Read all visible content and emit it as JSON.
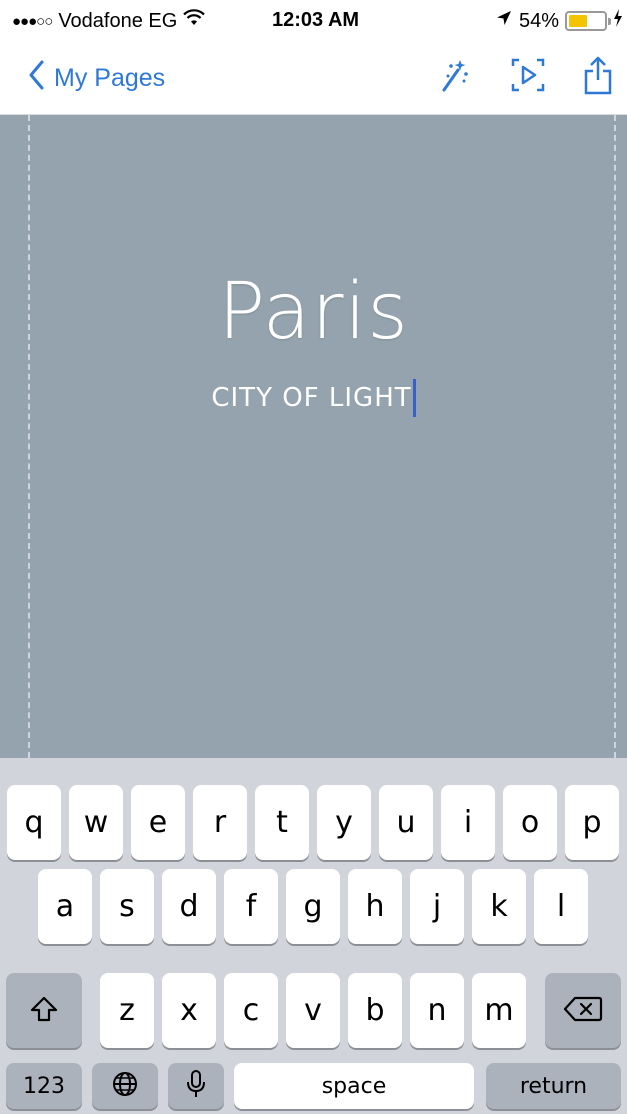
{
  "status_bar": {
    "signal": "●●●○○",
    "carrier": "Vodafone EG",
    "wifi_icon": "wifi-icon",
    "time": "12:03 AM",
    "location_icon": "location-arrow-icon",
    "battery_percent": "54%",
    "battery_level": 0.54,
    "charging_icon": "bolt-icon"
  },
  "nav": {
    "back_label": "My Pages",
    "icons": [
      "magic-wand-icon",
      "play-preview-icon",
      "share-icon"
    ]
  },
  "canvas": {
    "title": "Paris",
    "subtitle": "CITY OF LIGHT",
    "background_color": "#94a3ad"
  },
  "keyboard": {
    "row1": [
      "q",
      "w",
      "e",
      "r",
      "t",
      "y",
      "u",
      "i",
      "o",
      "p"
    ],
    "row2": [
      "a",
      "s",
      "d",
      "f",
      "g",
      "h",
      "j",
      "k",
      "l"
    ],
    "row3": [
      "z",
      "x",
      "c",
      "v",
      "b",
      "n",
      "m"
    ],
    "numbers_label": "123",
    "space_label": "space",
    "return_label": "return"
  },
  "colors": {
    "accent": "#2e78d6",
    "caret": "#3b5fc9",
    "battery": "#f5c400"
  }
}
